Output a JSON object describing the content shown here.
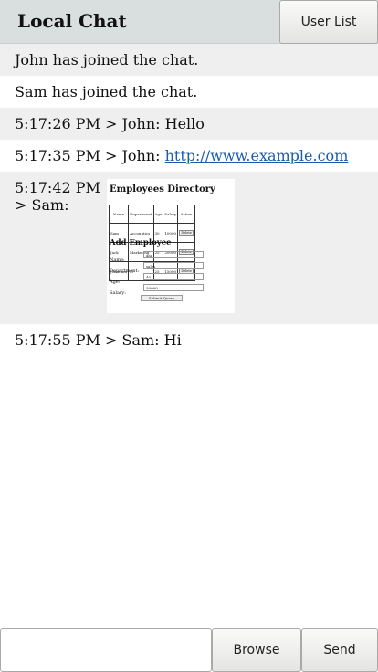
{
  "header": {
    "title": "Local Chat",
    "user_list_label": "User List"
  },
  "messages": [
    {
      "text": "John has joined the chat."
    },
    {
      "text": "Sam has joined the chat."
    },
    {
      "text": "5:17:26 PM > John: Hello"
    },
    {
      "prefix": "5:17:35 PM > John: ",
      "link": "http://www.example.com"
    },
    {
      "time": "5:17:42 PM",
      "sender": "> Sam:"
    },
    {
      "text": "5:17:55 PM > Sam: Hi"
    }
  ],
  "shared_image": {
    "title": "Employees Directory",
    "table": {
      "headers": [
        "Name",
        "Department",
        "Age",
        "Salary",
        "Action"
      ],
      "rows": [
        [
          "Sam",
          "Accountics",
          "30",
          "10000",
          "Delete"
        ],
        [
          "Jack",
          "Marketing",
          "25",
          "20000",
          "Delete"
        ],
        [
          "Jonathan",
          "IT",
          "25",
          "15000",
          "Delete"
        ]
      ]
    },
    "form_title": "Add Employee",
    "form": [
      {
        "label": "Name:",
        "value": "aaa"
      },
      {
        "label": "Department:",
        "value": "sales"
      },
      {
        "label": "Age:",
        "value": "40"
      },
      {
        "label": "Salary:",
        "value": "50000"
      }
    ],
    "submit_label": "Submit Query"
  },
  "composer": {
    "input_value": "",
    "browse_label": "Browse",
    "send_label": "Send"
  }
}
